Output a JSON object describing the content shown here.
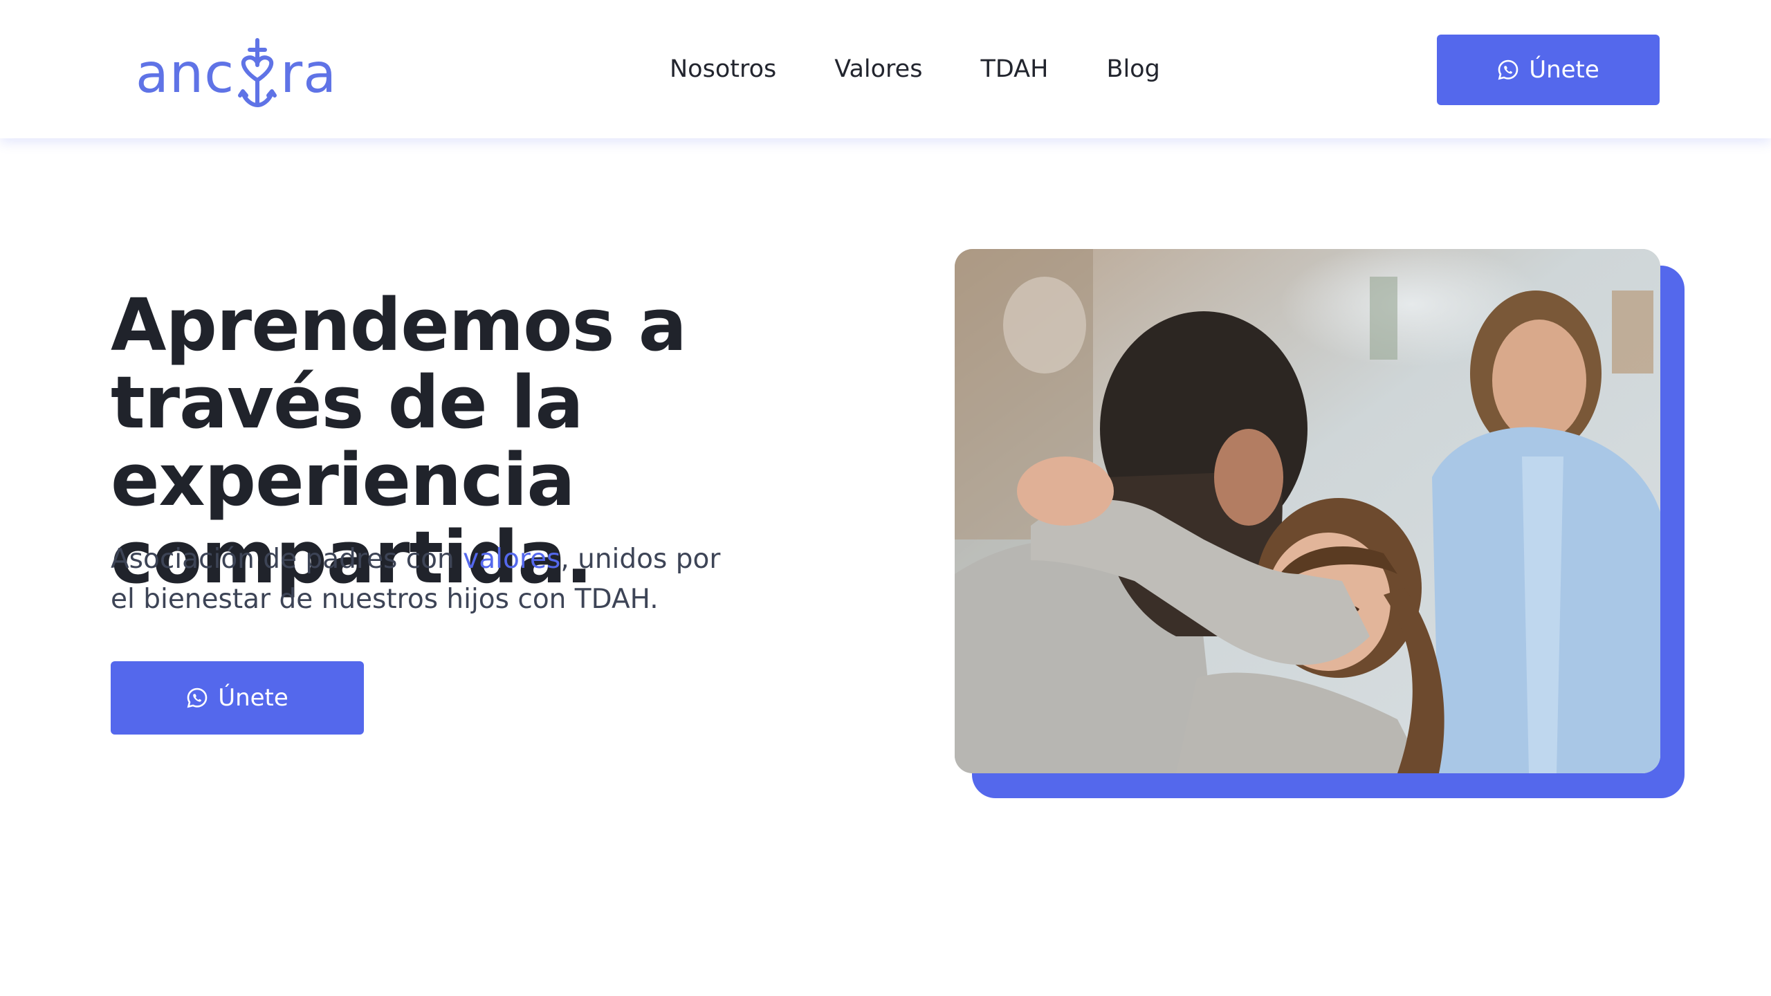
{
  "brand": {
    "name": "ancora",
    "color": "#5f73e6",
    "logo_left": "anc",
    "logo_right": "ra"
  },
  "nav": {
    "items": [
      {
        "label": "Nosotros"
      },
      {
        "label": "Valores"
      },
      {
        "label": "TDAH"
      },
      {
        "label": "Blog"
      }
    ]
  },
  "header": {
    "cta_label": "Únete",
    "cta_icon": "whatsapp-icon"
  },
  "hero": {
    "title": "Aprendemos a través de la experiencia compartida.",
    "subtitle_before": "Asociación de padres con ",
    "subtitle_accent": "valores",
    "subtitle_after": ", unidos por el bienestar de nuestros hijos con TDAH.",
    "cta_label": "Únete",
    "cta_icon": "whatsapp-icon",
    "image_alt": "Padre abrazando a su hija mientras la madre sonríe"
  },
  "colors": {
    "accent": "#5468ec",
    "text": "#20232b",
    "subtext": "#3d4456",
    "background": "#ffffff"
  }
}
